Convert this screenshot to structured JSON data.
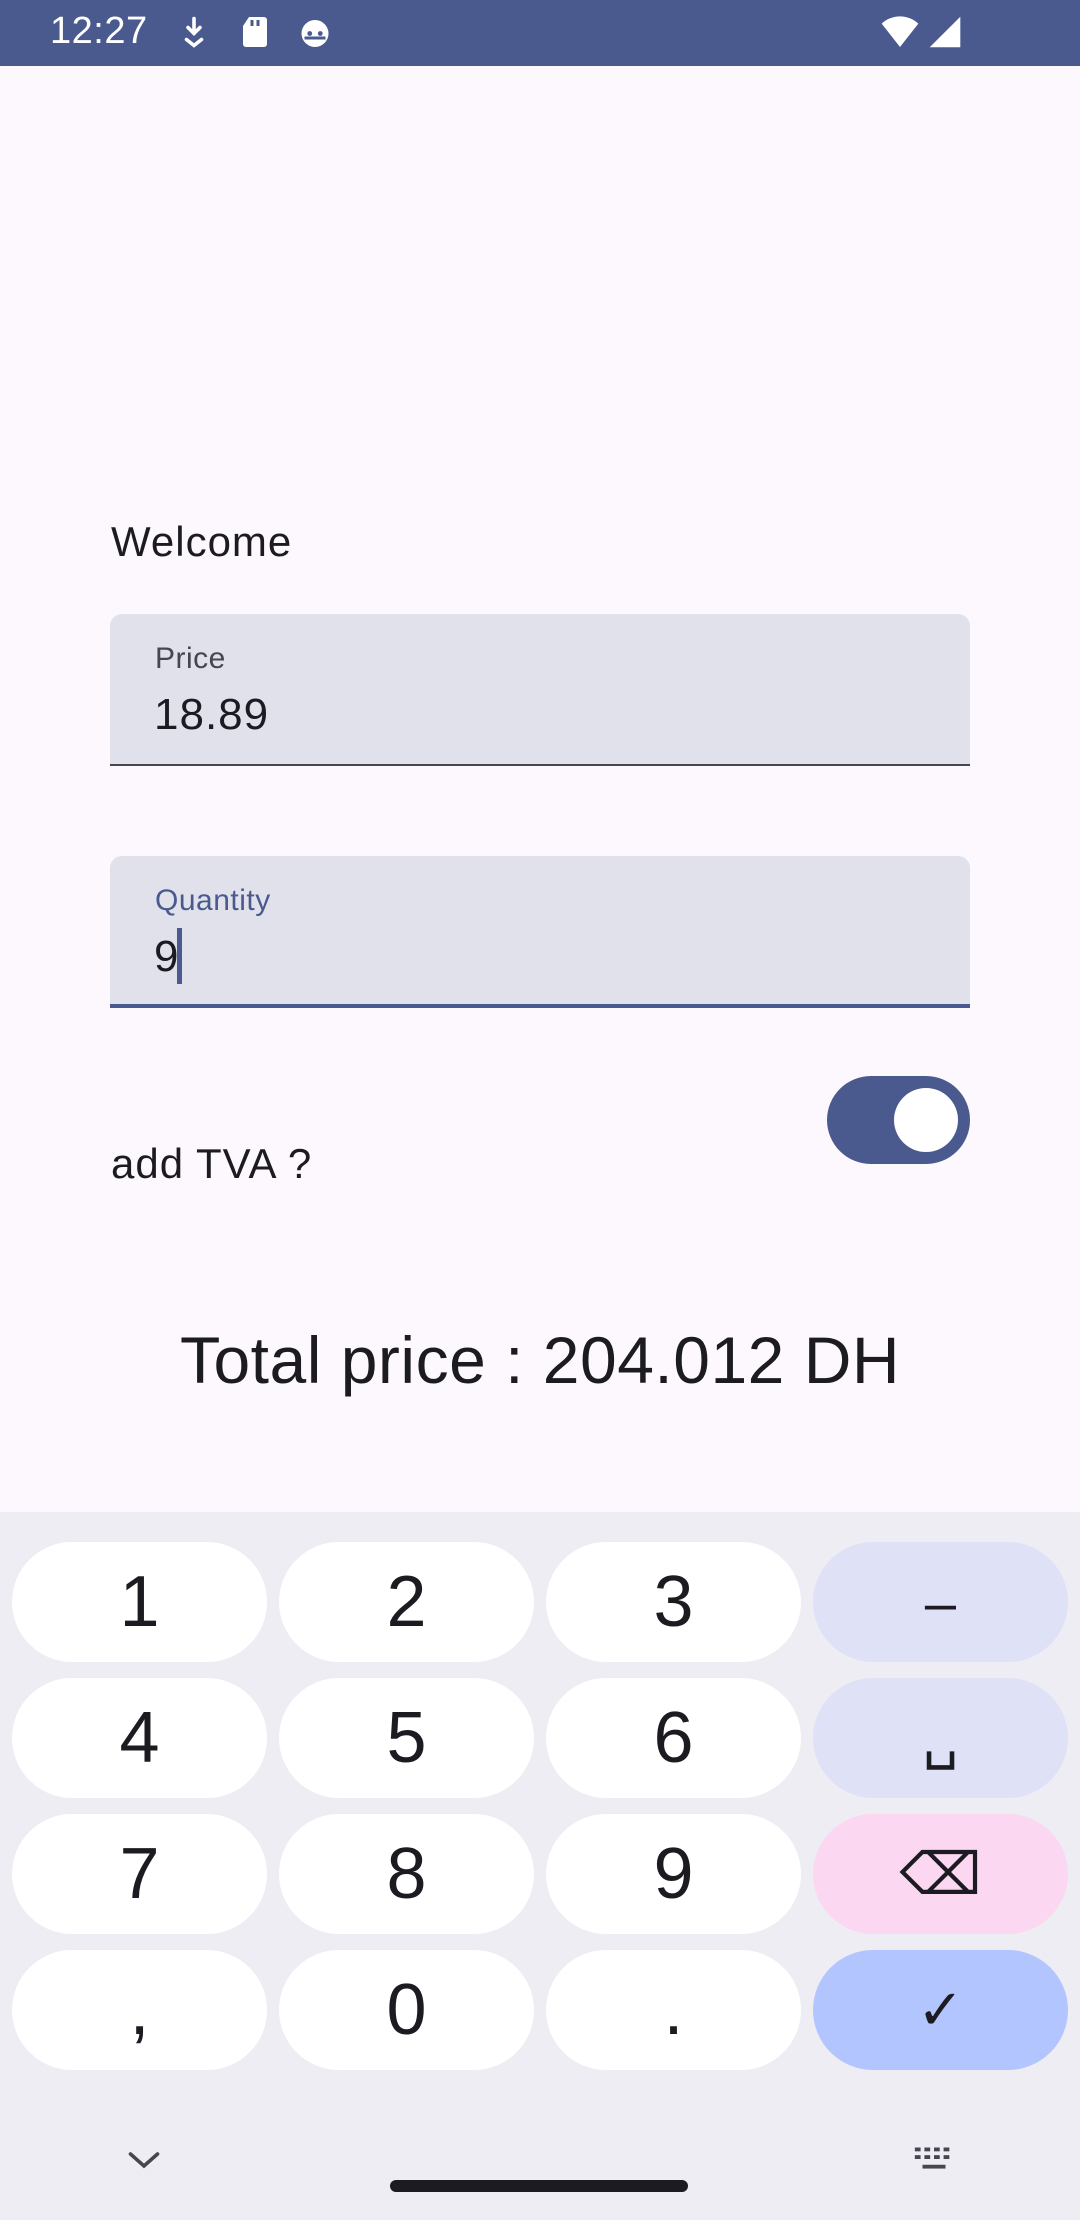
{
  "status_bar": {
    "time": "12:27",
    "icons": [
      "download-icon",
      "sdcard-icon",
      "android-face-icon",
      "wifi-icon",
      "signal-icon"
    ]
  },
  "form": {
    "welcome": "Welcome",
    "price": {
      "label": "Price",
      "value": "18.89"
    },
    "quantity": {
      "label": "Quantity",
      "value": "9"
    },
    "tva_label": "add TVA ?",
    "tva_enabled": true,
    "total": "Total price : 204.012 DH"
  },
  "keyboard": {
    "rows": [
      [
        "1",
        "2",
        "3",
        "–"
      ],
      [
        "4",
        "5",
        "6",
        "␣"
      ],
      [
        "7",
        "8",
        "9",
        "⌫"
      ],
      [
        ",",
        "0",
        ".",
        "✓"
      ]
    ]
  },
  "colors": {
    "primary": "#4a5a8e",
    "background": "#fdf8fd",
    "field_bg": "#e1e1ec",
    "key_delete": "#fbd7f2",
    "key_done": "#b3c5ff"
  }
}
